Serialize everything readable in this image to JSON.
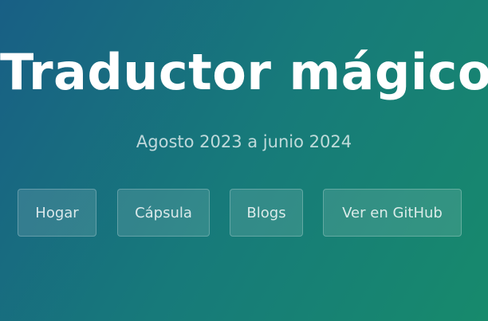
{
  "hero": {
    "title": "Traductor mágico",
    "subtitle": "Agosto 2023 a junio 2024"
  },
  "nav": {
    "buttons": [
      {
        "label": "Hogar"
      },
      {
        "label": "Cápsula"
      },
      {
        "label": "Blogs"
      },
      {
        "label": "Ver en GitHub"
      }
    ]
  },
  "colors": {
    "gradient_start": "#185f85",
    "gradient_end": "#178a6c",
    "text": "#ffffff"
  }
}
